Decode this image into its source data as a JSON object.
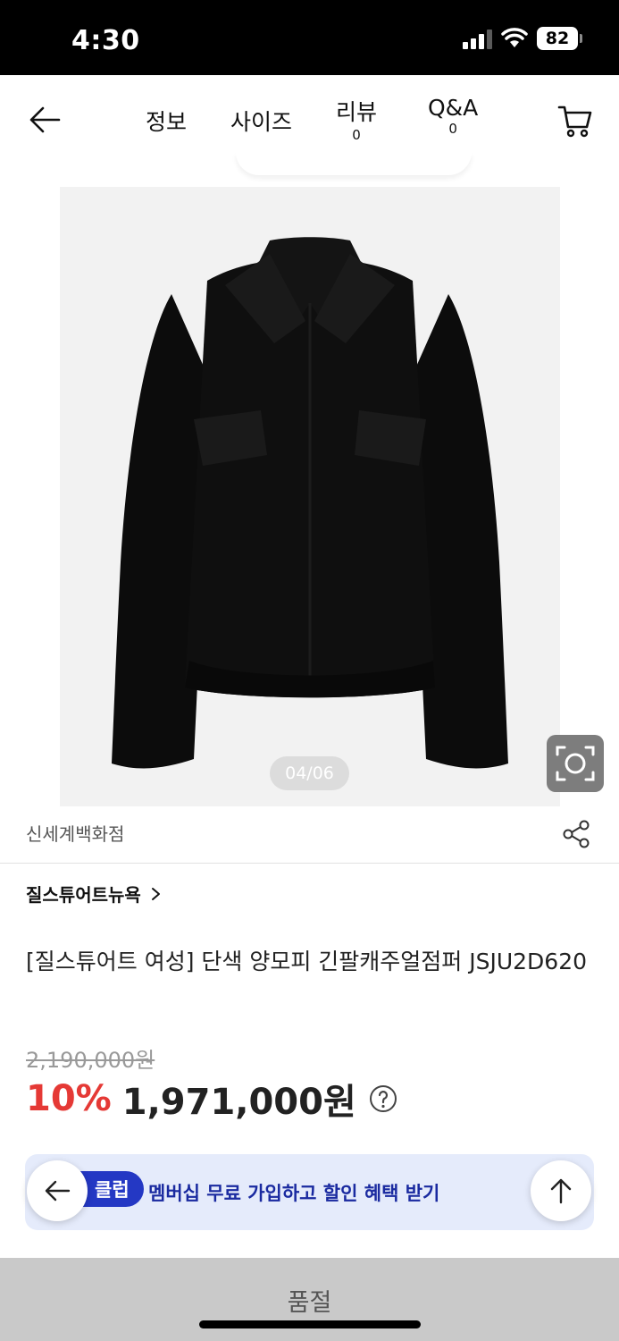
{
  "status_bar": {
    "time": "4:30",
    "battery": "82"
  },
  "nav": {
    "tabs": [
      {
        "label": "정보",
        "count": ""
      },
      {
        "label": "사이즈",
        "count": ""
      },
      {
        "label": "리뷰",
        "count": "0"
      },
      {
        "label": "Q&A",
        "count": "0"
      }
    ]
  },
  "gallery": {
    "counter": "04/06"
  },
  "seller": "신세계백화점",
  "brand": "질스튜어트뉴욕",
  "product": {
    "title": "[질스튜어트 여성] 단색 양모피 긴팔캐주얼점퍼 JSJU2D620",
    "original_price": "2,190,000원",
    "discount": "10%",
    "final_price": "1,971,000원"
  },
  "banner": {
    "badge": "클럽",
    "text": "멤버십 무료 가입하고 할인 혜택 받기"
  },
  "buy_button": {
    "label": "품절"
  },
  "colors": {
    "discount": "#e53935",
    "banner_bg": "#e5ebfb",
    "badge": "#2438c4",
    "soldout_bg": "#c9c9c9"
  }
}
